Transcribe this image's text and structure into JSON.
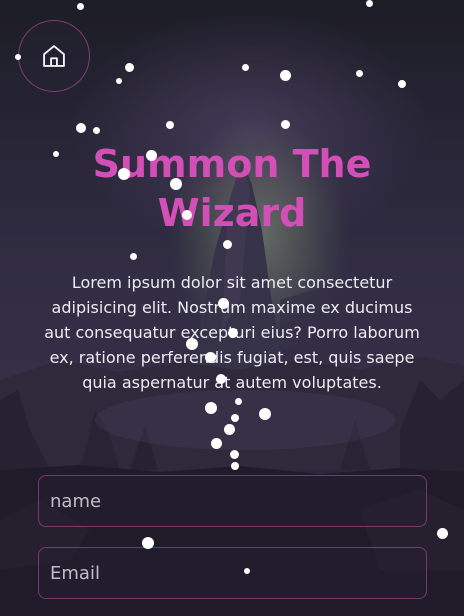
{
  "header": {
    "home_icon": "home-icon"
  },
  "main": {
    "title": "Summon The Wizard",
    "description": "Lorem ipsum dolor sit amet consectetur adipisicing elit. Nostrum maxime ex ducimus aut consequatur excepturi eius? Porro laborum ex, ratione perferendis fugiat, est, quis saepe quia aspernatur at autem voluptates."
  },
  "form": {
    "name_placeholder": "name",
    "email_placeholder": "Email"
  },
  "colors": {
    "accent": "#d14fb6",
    "text": "#ececf2",
    "field_border": "#be50a0"
  }
}
